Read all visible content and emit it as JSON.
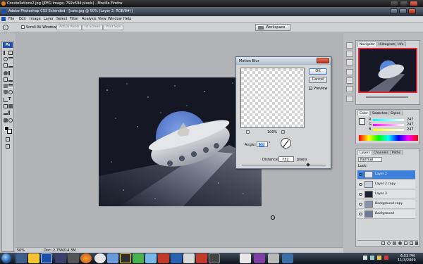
{
  "browser": {
    "title": "Constellations2.jpg (JPEG Image, 792x594 pixels) - Mozilla Firefox"
  },
  "photoshop": {
    "title": "Adobe Photoshop CS3 Extended - [cate.jpg @ 50% (Layer 2, RGB/8#)]",
    "menus": [
      "File",
      "Edit",
      "Image",
      "Layer",
      "Select",
      "Filter",
      "Analysis",
      "View",
      "Window",
      "Help"
    ],
    "options": {
      "scroll_all": "Scroll All Windows",
      "actual_pixels": "Actual Pixels",
      "fit_screen": "Fit Screen",
      "print_size": "Print Size",
      "workspace": "Workspace"
    },
    "toolbox_label": "Ps",
    "status": {
      "zoom": "50%",
      "doc": "Doc: 2.75M/14.3M"
    }
  },
  "dialog": {
    "title": "Motion Blur",
    "ok": "OK",
    "cancel": "Cancel",
    "preview_label": "Preview",
    "preview_checked": true,
    "zoom": "100%",
    "minus": "−",
    "plus": "+",
    "angle_label": "Angle:",
    "angle_value": "38",
    "angle_unit": "°",
    "distance_label": "Distance:",
    "distance_value": "732",
    "distance_unit": "pixels"
  },
  "panels": {
    "navigator_tabs": [
      "Navigator",
      "Histogram",
      "Info"
    ],
    "color_tabs": [
      "Color",
      "Swatches",
      "Styles"
    ],
    "color": {
      "channels": [
        {
          "label": "R",
          "value": "247"
        },
        {
          "label": "G",
          "value": "247"
        },
        {
          "label": "B",
          "value": "247"
        }
      ]
    },
    "layers_tabs": [
      "Layers",
      "Channels",
      "Paths"
    ],
    "blend_mode": "Normal",
    "lock_label": "Lock:",
    "layers": [
      {
        "name": "Layer 2",
        "selected": true
      },
      {
        "name": "Layer 2 copy",
        "selected": false
      },
      {
        "name": "Layer 3",
        "selected": false
      },
      {
        "name": "Background copy",
        "selected": false
      },
      {
        "name": "Background",
        "selected": false
      }
    ]
  },
  "taskbar": {
    "time": "6:53 PM",
    "date": "11/3/2009"
  },
  "colors": {
    "selection": "#3c80dc",
    "dialog_title": "#aebccd",
    "space": "#151824",
    "ufo_dome": "#5b87d8"
  }
}
